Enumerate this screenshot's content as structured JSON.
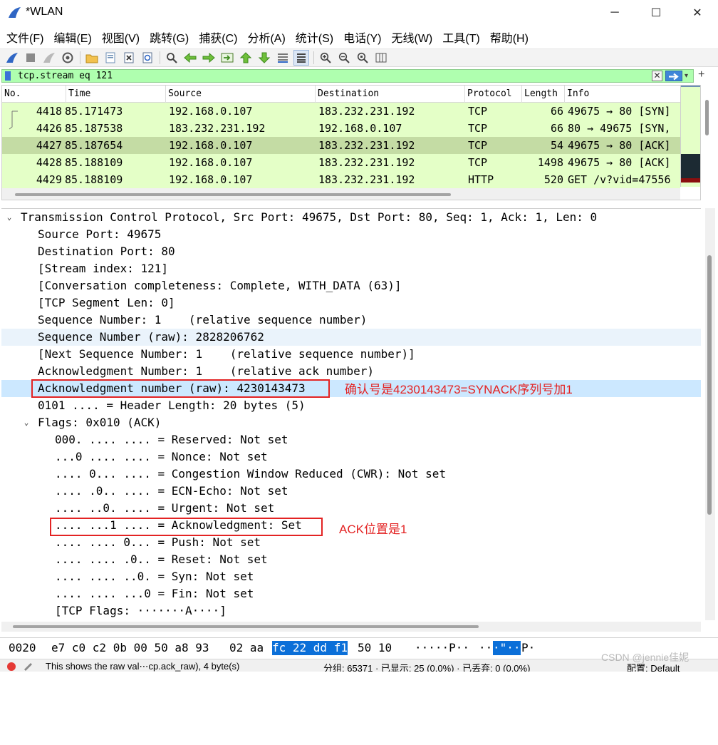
{
  "window": {
    "title": "*WLAN",
    "minimize_glyph": "─",
    "maximize_glyph": "☐",
    "close_glyph": "✕"
  },
  "menu": [
    "文件(F)",
    "编辑(E)",
    "视图(V)",
    "跳转(G)",
    "捕获(C)",
    "分析(A)",
    "统计(S)",
    "电话(Y)",
    "无线(W)",
    "工具(T)",
    "帮助(H)"
  ],
  "toolbar": {
    "icons": [
      "shark-fin-icon",
      "stop-icon",
      "restart-icon",
      "options-icon",
      "open-folder-icon",
      "save-icon",
      "close-file-icon",
      "reload-icon",
      "find-icon",
      "go-back-icon",
      "go-forward-icon",
      "go-to-packet-icon",
      "first-packet-icon",
      "last-packet-icon",
      "autoscroll-icon",
      "colorize-icon",
      "zoom-in-icon",
      "zoom-out-icon",
      "zoom-reset-icon",
      "resize-columns-icon"
    ]
  },
  "filter": {
    "value": "tcp.stream eq 121",
    "clear_glyph": "✕",
    "dropdown_glyph": "▾",
    "plus_glyph": "+"
  },
  "packet_list": {
    "columns": [
      "No.",
      "Time",
      "Source",
      "Destination",
      "Protocol",
      "Length",
      "Info"
    ],
    "rows": [
      {
        "no": "4418",
        "time": "85.171473",
        "src": "192.168.0.107",
        "dst": "183.232.231.192",
        "proto": "TCP",
        "len": "66",
        "info": "49675 → 80 [SYN]"
      },
      {
        "no": "4426",
        "time": "85.187538",
        "src": "183.232.231.192",
        "dst": "192.168.0.107",
        "proto": "TCP",
        "len": "66",
        "info": "80 → 49675 [SYN,"
      },
      {
        "no": "4427",
        "time": "85.187654",
        "src": "192.168.0.107",
        "dst": "183.232.231.192",
        "proto": "TCP",
        "len": "54",
        "info": "49675 → 80 [ACK]"
      },
      {
        "no": "4428",
        "time": "85.188109",
        "src": "192.168.0.107",
        "dst": "183.232.231.192",
        "proto": "TCP",
        "len": "1498",
        "info": "49675 → 80 [ACK]"
      },
      {
        "no": "4429",
        "time": "85.188109",
        "src": "192.168.0.107",
        "dst": "183.232.231.192",
        "proto": "HTTP",
        "len": "520",
        "info": "GET /v?vid=47556"
      }
    ]
  },
  "details": {
    "lines": [
      "Transmission Control Protocol, Src Port: 49675, Dst Port: 80, Seq: 1, Ack: 1, Len: 0",
      "Source Port: 49675",
      "Destination Port: 80",
      "[Stream index: 121]",
      "[Conversation completeness: Complete, WITH_DATA (63)]",
      "[TCP Segment Len: 0]",
      "Sequence Number: 1    (relative sequence number)",
      "Sequence Number (raw): 2828206762",
      "[Next Sequence Number: 1    (relative sequence number)]",
      "Acknowledgment Number: 1    (relative ack number)",
      "Acknowledgment number (raw): 4230143473",
      "0101 .... = Header Length: 20 bytes (5)",
      "Flags: 0x010 (ACK)",
      "000. .... .... = Reserved: Not set",
      "...0 .... .... = Nonce: Not set",
      ".... 0... .... = Congestion Window Reduced (CWR): Not set",
      ".... .0.. .... = ECN-Echo: Not set",
      ".... ..0. .... = Urgent: Not set",
      ".... ...1 .... = Acknowledgment: Set",
      ".... .... 0... = Push: Not set",
      ".... .... .0.. = Reset: Not set",
      ".... .... ..0. = Syn: Not set",
      ".... .... ...0 = Fin: Not set",
      "[TCP Flags: ·······A····]"
    ],
    "expanded_glyph": "⌄"
  },
  "annotations": {
    "ack_raw_note": "确认号是4230143473=SYNACK序列号加1",
    "ack_flag_note": "ACK位置是1"
  },
  "hex": {
    "offset": "0020",
    "bytes_a": "e7 c0 c2 0b 00 50 a8 93",
    "bytes_b": "02 aa",
    "bytes_sel": "fc 22 dd f1",
    "bytes_c": "50 10",
    "ascii_a": "·····P··",
    "ascii_b": "··",
    "ascii_sel": "·\"··",
    "ascii_c": "P·"
  },
  "status": {
    "hint": "This shows the raw val⋯cp.ack_raw), 4 byte(s)",
    "packets": "分组: 65371 · 已显示: 25 (0.0%) · 已丢弃: 0 (0.0%)",
    "profile": "配置: Default"
  },
  "watermark": "CSDN @jennie佳妮",
  "colors": {
    "row_bg": "#e4ffc7",
    "row_selected_bg": "#c4dca4",
    "filter_bg": "#afffaf",
    "annotation_red": "#e32323",
    "hex_selected": "#0b6fd8",
    "detail_selected_bg": "#cce8ff"
  }
}
